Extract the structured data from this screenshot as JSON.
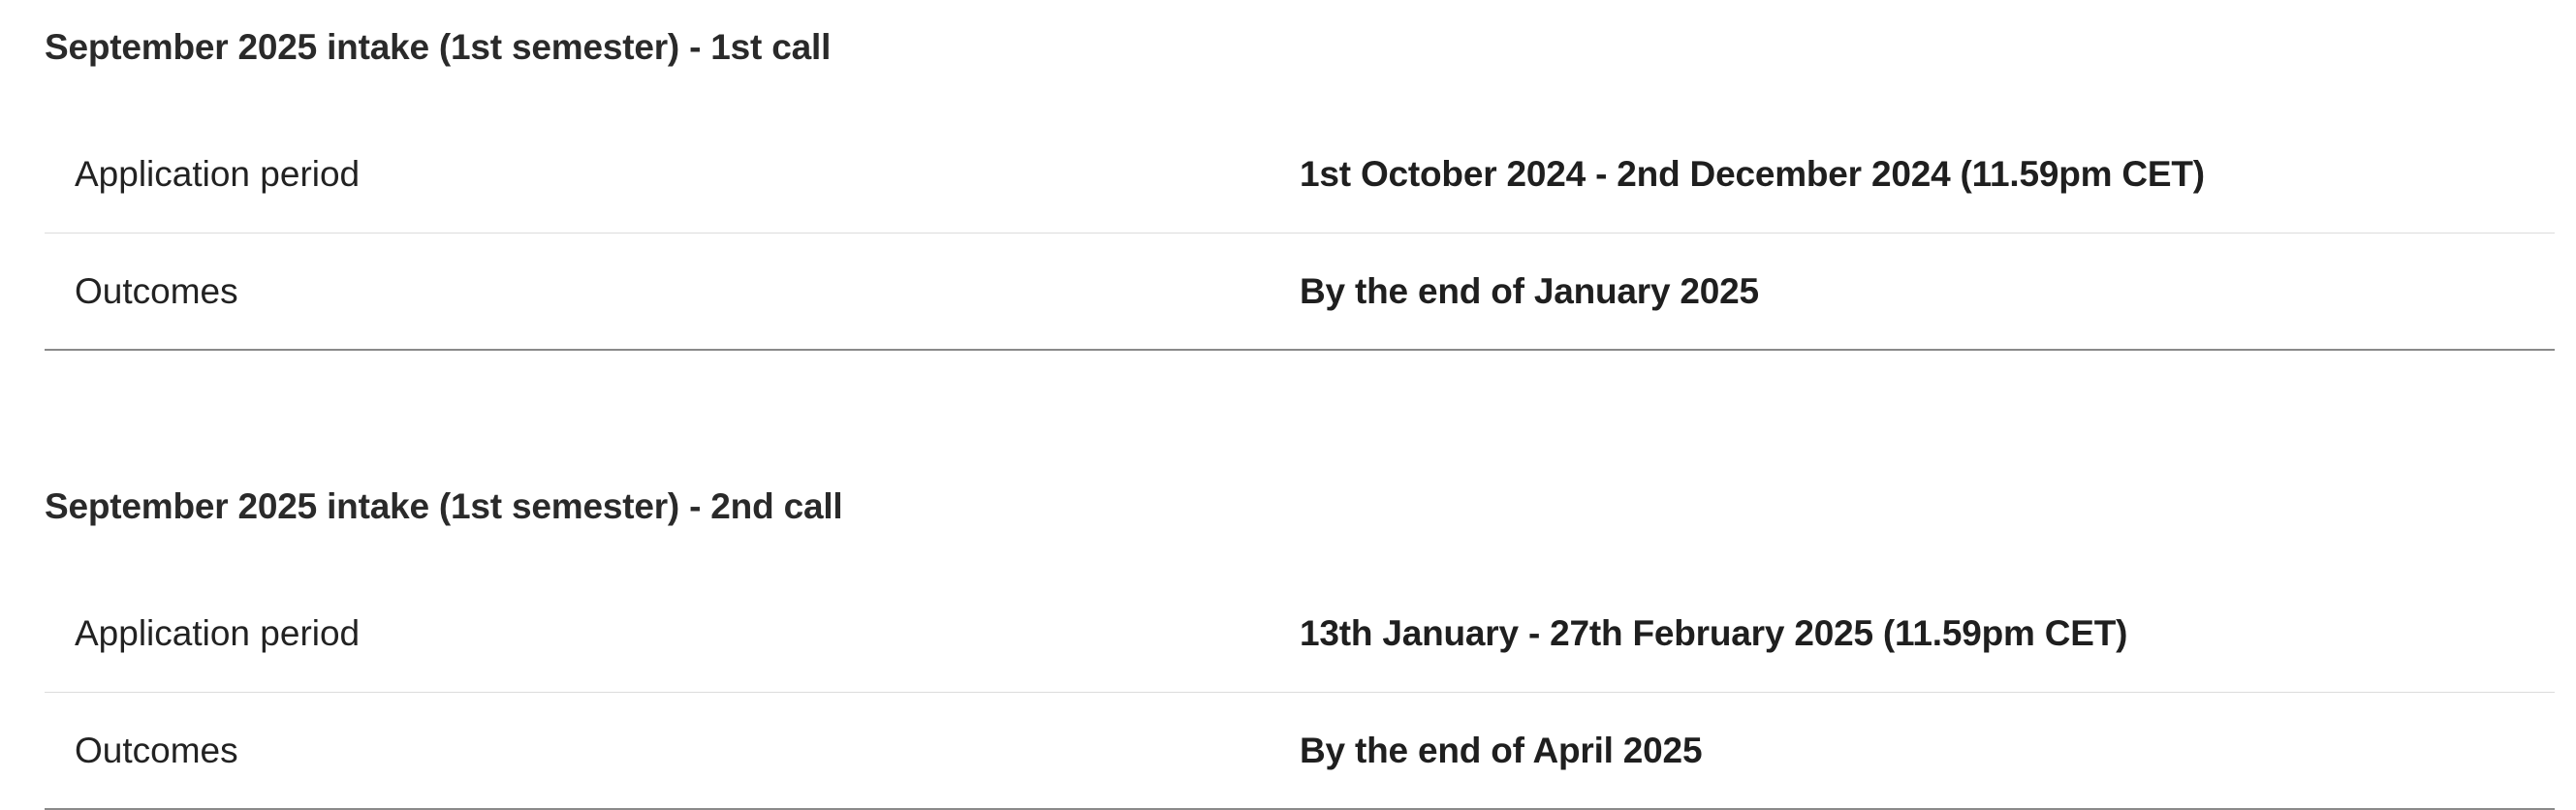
{
  "sections": [
    {
      "title": "September 2025 intake (1st semester) - 1st call",
      "rows": [
        {
          "label": "Application period",
          "value": "1st October 2024 - 2nd December 2024 (11.59pm CET)"
        },
        {
          "label": "Outcomes",
          "value": "By the end of January 2025"
        }
      ]
    },
    {
      "title": "September 2025 intake (1st semester) - 2nd call",
      "rows": [
        {
          "label": "Application period",
          "value": "13th January - 27th February 2025 (11.59pm CET)"
        },
        {
          "label": "Outcomes",
          "value": "By the end of April 2025"
        }
      ]
    }
  ]
}
